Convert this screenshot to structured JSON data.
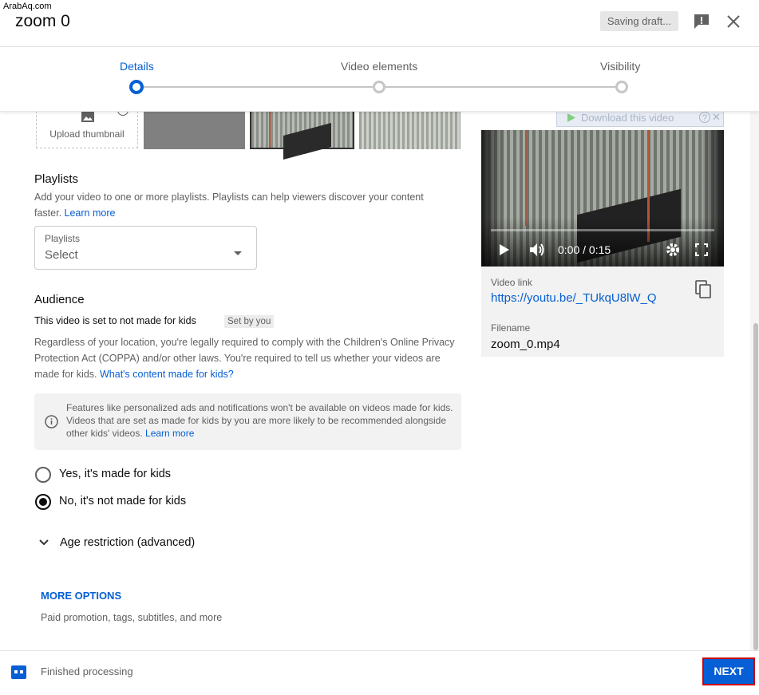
{
  "watermark": "ArabAq.com",
  "header": {
    "title": "zoom 0",
    "saving_label": "Saving draft...",
    "feedback_icon": "feedback-icon",
    "close_icon": "close-icon"
  },
  "steps": [
    {
      "label": "Details",
      "active": true
    },
    {
      "label": "Video elements",
      "active": false
    },
    {
      "label": "Visibility",
      "active": false
    }
  ],
  "thumbnail": {
    "upload_label": "Upload thumbnail"
  },
  "playlists": {
    "title": "Playlists",
    "description": "Add your video to one or more playlists. Playlists can help viewers discover your content faster.",
    "learn_more": "Learn more",
    "select_label": "Playlists",
    "select_value": "Select"
  },
  "audience": {
    "title": "Audience",
    "status_text": "This video is set to not made for kids",
    "set_by_badge": "Set by you",
    "description": "Regardless of your location, you're legally required to comply with the Children's Online Privacy Protection Act (COPPA) and/or other laws. You're required to tell us whether your videos are made for kids.",
    "content_link": "What's content made for kids?",
    "info_text": "Features like personalized ads and notifications won't be available on videos made for kids. Videos that are set as made for kids by you are more likely to be recommended alongside other kids' videos.",
    "info_learn_more": "Learn more",
    "options": [
      {
        "label": "Yes, it's made for kids",
        "checked": false
      },
      {
        "label": "No, it's not made for kids",
        "checked": true
      }
    ],
    "age_restriction": "Age restriction (advanced)"
  },
  "more_options": {
    "label": "MORE OPTIONS",
    "description": "Paid promotion, tags, subtitles, and more"
  },
  "video_panel": {
    "download_label": "Download this video",
    "time": "0:00 / 0:15",
    "progress": 0.0,
    "video_link_label": "Video link",
    "video_link": "https://youtu.be/_TUkqU8lW_Q",
    "filename_label": "Filename",
    "filename": "zoom_0.mp4"
  },
  "footer": {
    "status": "Finished processing",
    "next_label": "NEXT"
  },
  "colors": {
    "accent": "#065fd4",
    "next_border": "#cc0000"
  }
}
